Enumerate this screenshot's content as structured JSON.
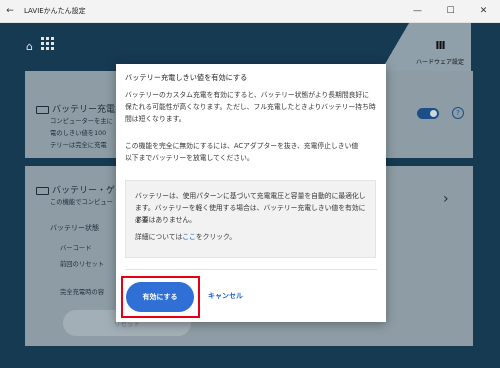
{
  "window": {
    "back_glyph": "←",
    "title": "LAVIEかんたん設定",
    "minimize_glyph": "—",
    "maximize_glyph": "☐",
    "close_glyph": "✕"
  },
  "header": {
    "home_icon": "home-icon",
    "grid_icon": "grid-icon",
    "hardware_icon": "hardware-settings-icon",
    "hardware_label": "ハードウェア設定"
  },
  "card_battery_charge": {
    "title": "バッテリー充電の",
    "lines": [
      "コンピューターを主に",
      "電のしきい値を100",
      "テリーは完全に充電"
    ],
    "toggle_on": true,
    "help_glyph": "?"
  },
  "card_battery_gauge": {
    "title": "バッテリー・ゲージ",
    "subtitle": "この機能でコンピュー",
    "status_heading": "バッテリー状態",
    "barcode_label": "バーコード",
    "last_reset_label": "前回のリセット",
    "full_charge_label": "完全充電時の容",
    "reset_label": "リセット",
    "chevron_glyph": "›"
  },
  "dialog": {
    "title": "バッテリー充電しきい値を有効にする",
    "paragraph1": [
      "バッテリーのカスタム充電を有効にすると、バッテリー状態がより長期間良好に",
      "保たれる可能性が高くなります。ただし、フル充電したときよりバッテリー持ち時",
      "間は短くなります。"
    ],
    "paragraph2": [
      "この機能を完全に無効にするには、ACアダプターを抜き、充電停止しきい値",
      "以下までバッテリーを放電してください。"
    ],
    "note": [
      "バッテリーは、使用パターンに基づいて充電電圧と容量を自動的に最適化し",
      "ます。バッテリーを軽く使用する場合は、バッテリー充電しきい値を有効にする",
      "必要はありません。"
    ],
    "details_prefix": "詳細については",
    "details_link": "ここ",
    "details_suffix": "をクリック。",
    "enable_label": "有効にする",
    "cancel_label": "キャンセル"
  }
}
